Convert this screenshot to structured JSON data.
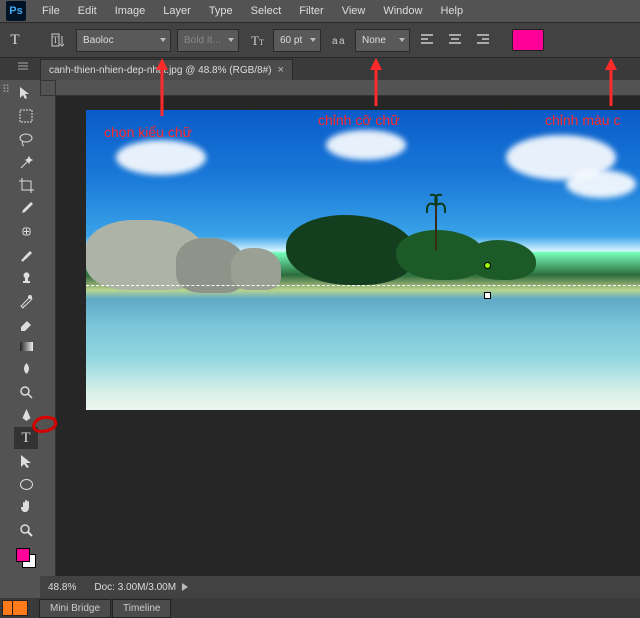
{
  "logo": "Ps",
  "menu": [
    "File",
    "Edit",
    "Image",
    "Layer",
    "Type",
    "Select",
    "Filter",
    "View",
    "Window",
    "Help"
  ],
  "options": {
    "font": "Baoloc",
    "style": "Bold It...",
    "size": "60 pt",
    "aa_icon_hint": "aa",
    "antialias": "None"
  },
  "tab": {
    "title": "canh-thien-nhien-dep-nhat.jpg @ 48.8% (RGB/8#)",
    "close": "×"
  },
  "status": {
    "zoom": "48.8%",
    "doc": "Doc: 3.00M/3.00M"
  },
  "panels": {
    "mini": "Mini Bridge",
    "timeline": "Timeline"
  },
  "colors": {
    "swatch": "#ff0099",
    "fg": "#ff0099",
    "bg": "#ffffff"
  },
  "annotations": {
    "font": "chọn kiểu chữ",
    "size": "chỉnh cỡ chữ",
    "color": "chỉnh màu c"
  }
}
